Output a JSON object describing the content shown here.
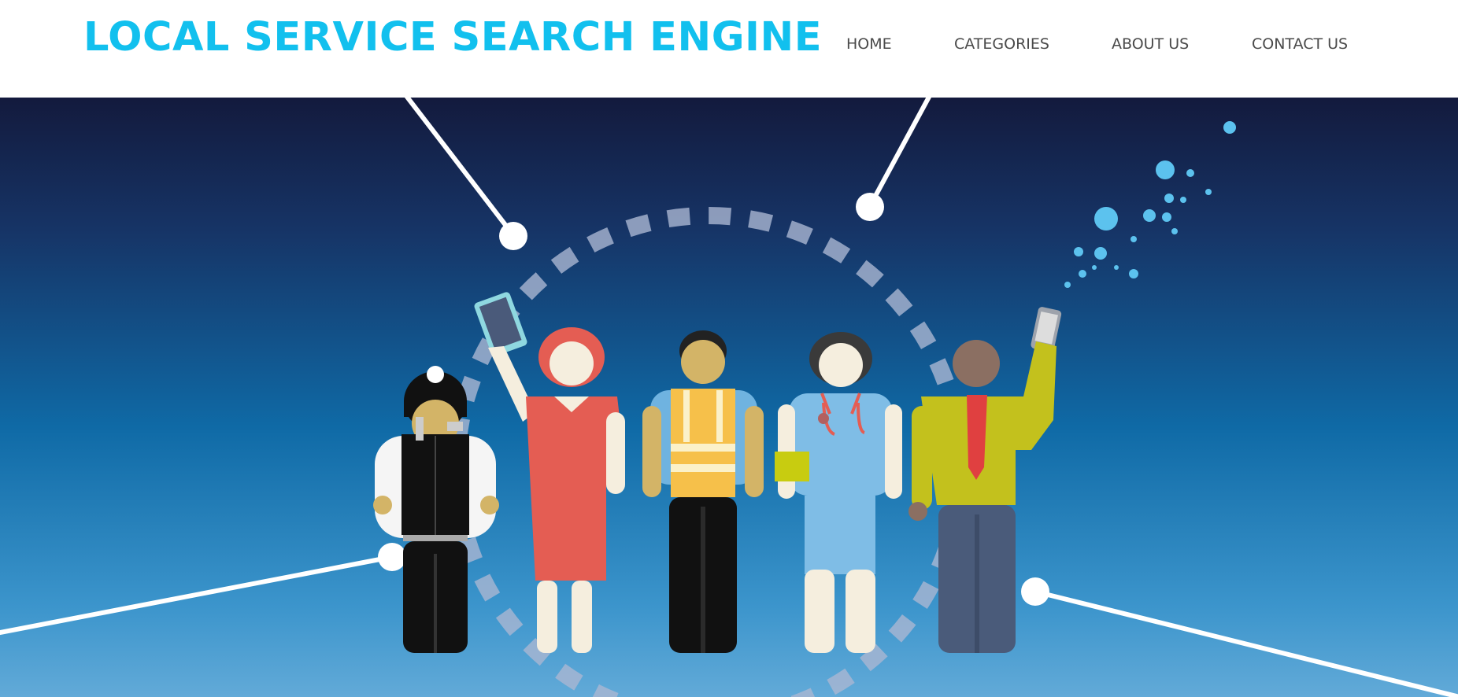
{
  "header": {
    "brand": "LOCAL SERVICE SEARCH ENGINE",
    "nav": [
      {
        "id": "home",
        "label": "HOME"
      },
      {
        "id": "categories",
        "label": "CATEGORIES"
      },
      {
        "id": "about",
        "label": "ABOUT US"
      },
      {
        "id": "contact",
        "label": "CONTACT US"
      }
    ]
  },
  "colors": {
    "brand": "#12c0ee",
    "nav_text": "#4a4a4a",
    "hero_top": "#131a3d",
    "hero_bottom": "#5fa9d8"
  },
  "hero": {
    "illustration": "community-service-workers",
    "figures": [
      "police-officer",
      "woman-with-tablet",
      "worker-in-hi-vis-vest",
      "nurse-with-stethoscope",
      "man-with-phone"
    ]
  }
}
